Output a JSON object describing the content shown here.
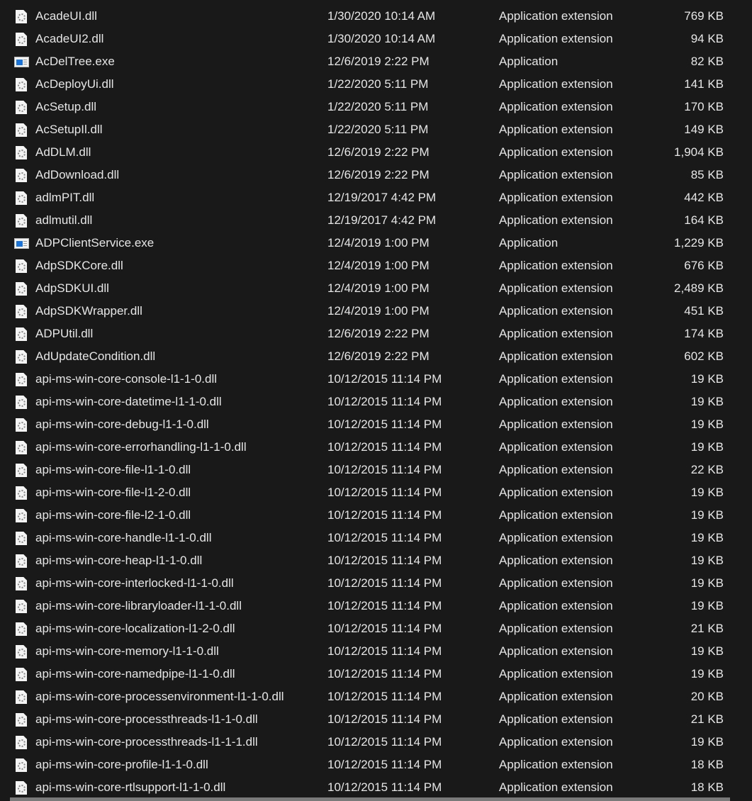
{
  "files": [
    {
      "name": "AcadeUI.dll",
      "date": "1/30/2020 10:14 AM",
      "type": "Application extension",
      "size": "769 KB",
      "icon": "dll-icon"
    },
    {
      "name": "AcadeUI2.dll",
      "date": "1/30/2020 10:14 AM",
      "type": "Application extension",
      "size": "94 KB",
      "icon": "dll-icon"
    },
    {
      "name": "AcDelTree.exe",
      "date": "12/6/2019 2:22 PM",
      "type": "Application",
      "size": "82 KB",
      "icon": "exe-icon"
    },
    {
      "name": "AcDeployUi.dll",
      "date": "1/22/2020 5:11 PM",
      "type": "Application extension",
      "size": "141 KB",
      "icon": "dll-icon"
    },
    {
      "name": "AcSetup.dll",
      "date": "1/22/2020 5:11 PM",
      "type": "Application extension",
      "size": "170 KB",
      "icon": "dll-icon"
    },
    {
      "name": "AcSetupIl.dll",
      "date": "1/22/2020 5:11 PM",
      "type": "Application extension",
      "size": "149 KB",
      "icon": "dll-icon"
    },
    {
      "name": "AdDLM.dll",
      "date": "12/6/2019 2:22 PM",
      "type": "Application extension",
      "size": "1,904 KB",
      "icon": "dll-icon"
    },
    {
      "name": "AdDownload.dll",
      "date": "12/6/2019 2:22 PM",
      "type": "Application extension",
      "size": "85 KB",
      "icon": "dll-icon"
    },
    {
      "name": "adlmPIT.dll",
      "date": "12/19/2017 4:42 PM",
      "type": "Application extension",
      "size": "442 KB",
      "icon": "dll-icon"
    },
    {
      "name": "adlmutil.dll",
      "date": "12/19/2017 4:42 PM",
      "type": "Application extension",
      "size": "164 KB",
      "icon": "dll-icon"
    },
    {
      "name": "ADPClientService.exe",
      "date": "12/4/2019 1:00 PM",
      "type": "Application",
      "size": "1,229 KB",
      "icon": "exe-icon"
    },
    {
      "name": "AdpSDKCore.dll",
      "date": "12/4/2019 1:00 PM",
      "type": "Application extension",
      "size": "676 KB",
      "icon": "dll-icon"
    },
    {
      "name": "AdpSDKUI.dll",
      "date": "12/4/2019 1:00 PM",
      "type": "Application extension",
      "size": "2,489 KB",
      "icon": "dll-icon"
    },
    {
      "name": "AdpSDKWrapper.dll",
      "date": "12/4/2019 1:00 PM",
      "type": "Application extension",
      "size": "451 KB",
      "icon": "dll-icon"
    },
    {
      "name": "ADPUtil.dll",
      "date": "12/6/2019 2:22 PM",
      "type": "Application extension",
      "size": "174 KB",
      "icon": "dll-icon"
    },
    {
      "name": "AdUpdateCondition.dll",
      "date": "12/6/2019 2:22 PM",
      "type": "Application extension",
      "size": "602 KB",
      "icon": "dll-icon"
    },
    {
      "name": "api-ms-win-core-console-l1-1-0.dll",
      "date": "10/12/2015 11:14 PM",
      "type": "Application extension",
      "size": "19 KB",
      "icon": "dll-icon"
    },
    {
      "name": "api-ms-win-core-datetime-l1-1-0.dll",
      "date": "10/12/2015 11:14 PM",
      "type": "Application extension",
      "size": "19 KB",
      "icon": "dll-icon"
    },
    {
      "name": "api-ms-win-core-debug-l1-1-0.dll",
      "date": "10/12/2015 11:14 PM",
      "type": "Application extension",
      "size": "19 KB",
      "icon": "dll-icon"
    },
    {
      "name": "api-ms-win-core-errorhandling-l1-1-0.dll",
      "date": "10/12/2015 11:14 PM",
      "type": "Application extension",
      "size": "19 KB",
      "icon": "dll-icon"
    },
    {
      "name": "api-ms-win-core-file-l1-1-0.dll",
      "date": "10/12/2015 11:14 PM",
      "type": "Application extension",
      "size": "22 KB",
      "icon": "dll-icon"
    },
    {
      "name": "api-ms-win-core-file-l1-2-0.dll",
      "date": "10/12/2015 11:14 PM",
      "type": "Application extension",
      "size": "19 KB",
      "icon": "dll-icon"
    },
    {
      "name": "api-ms-win-core-file-l2-1-0.dll",
      "date": "10/12/2015 11:14 PM",
      "type": "Application extension",
      "size": "19 KB",
      "icon": "dll-icon"
    },
    {
      "name": "api-ms-win-core-handle-l1-1-0.dll",
      "date": "10/12/2015 11:14 PM",
      "type": "Application extension",
      "size": "19 KB",
      "icon": "dll-icon"
    },
    {
      "name": "api-ms-win-core-heap-l1-1-0.dll",
      "date": "10/12/2015 11:14 PM",
      "type": "Application extension",
      "size": "19 KB",
      "icon": "dll-icon"
    },
    {
      "name": "api-ms-win-core-interlocked-l1-1-0.dll",
      "date": "10/12/2015 11:14 PM",
      "type": "Application extension",
      "size": "19 KB",
      "icon": "dll-icon"
    },
    {
      "name": "api-ms-win-core-libraryloader-l1-1-0.dll",
      "date": "10/12/2015 11:14 PM",
      "type": "Application extension",
      "size": "19 KB",
      "icon": "dll-icon"
    },
    {
      "name": "api-ms-win-core-localization-l1-2-0.dll",
      "date": "10/12/2015 11:14 PM",
      "type": "Application extension",
      "size": "21 KB",
      "icon": "dll-icon"
    },
    {
      "name": "api-ms-win-core-memory-l1-1-0.dll",
      "date": "10/12/2015 11:14 PM",
      "type": "Application extension",
      "size": "19 KB",
      "icon": "dll-icon"
    },
    {
      "name": "api-ms-win-core-namedpipe-l1-1-0.dll",
      "date": "10/12/2015 11:14 PM",
      "type": "Application extension",
      "size": "19 KB",
      "icon": "dll-icon"
    },
    {
      "name": "api-ms-win-core-processenvironment-l1-1-0.dll",
      "date": "10/12/2015 11:14 PM",
      "type": "Application extension",
      "size": "20 KB",
      "icon": "dll-icon"
    },
    {
      "name": "api-ms-win-core-processthreads-l1-1-0.dll",
      "date": "10/12/2015 11:14 PM",
      "type": "Application extension",
      "size": "21 KB",
      "icon": "dll-icon"
    },
    {
      "name": "api-ms-win-core-processthreads-l1-1-1.dll",
      "date": "10/12/2015 11:14 PM",
      "type": "Application extension",
      "size": "19 KB",
      "icon": "dll-icon"
    },
    {
      "name": "api-ms-win-core-profile-l1-1-0.dll",
      "date": "10/12/2015 11:14 PM",
      "type": "Application extension",
      "size": "18 KB",
      "icon": "dll-icon"
    },
    {
      "name": "api-ms-win-core-rtlsupport-l1-1-0.dll",
      "date": "10/12/2015 11:14 PM",
      "type": "Application extension",
      "size": "18 KB",
      "icon": "dll-icon"
    }
  ]
}
